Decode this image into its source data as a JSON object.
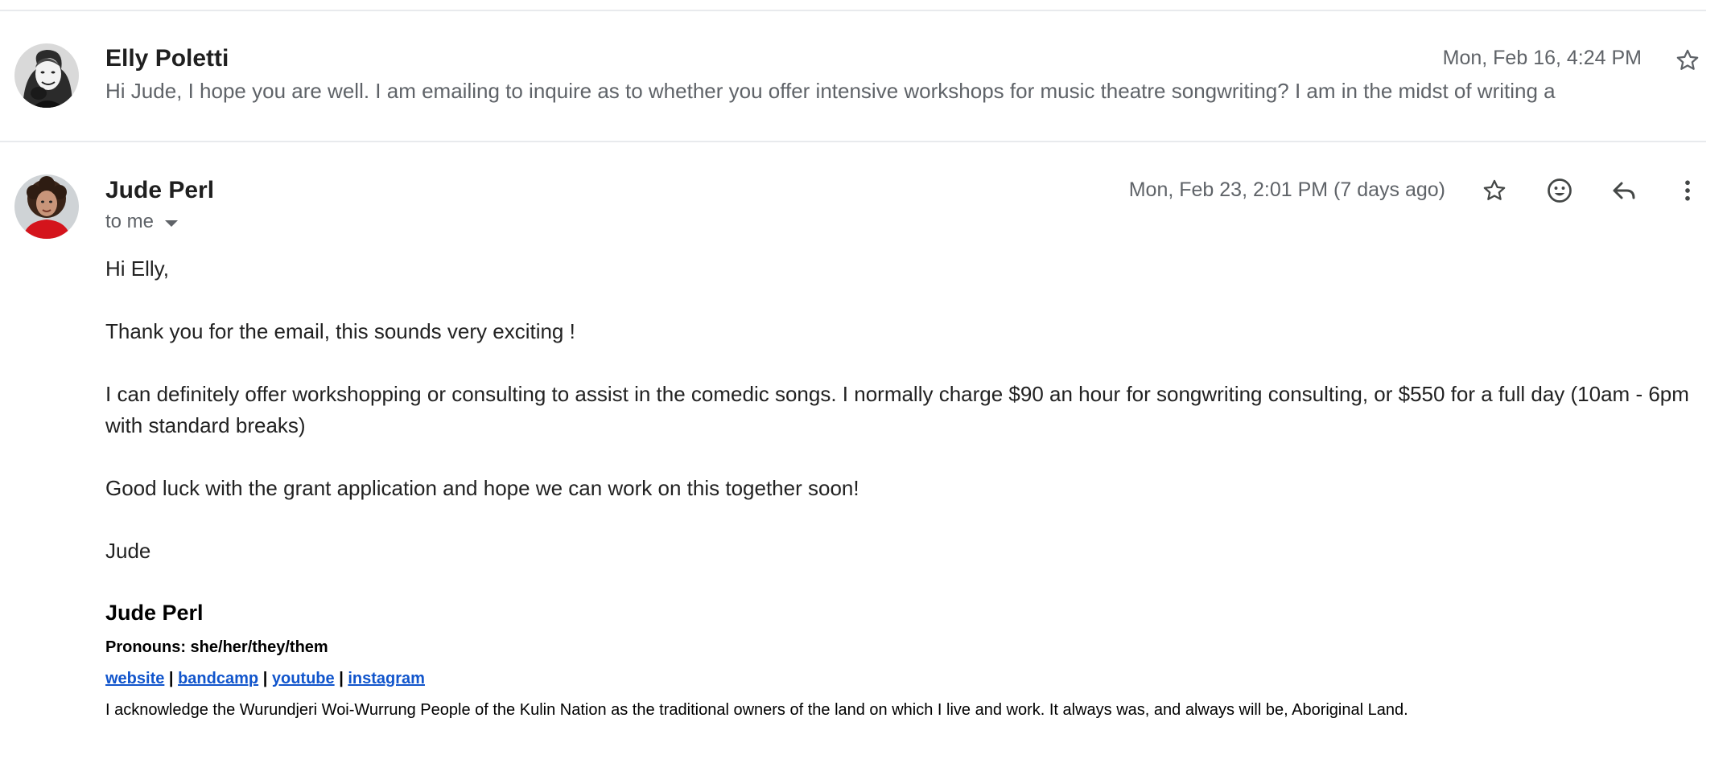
{
  "thread": {
    "messages": [
      {
        "sender": "Elly Poletti",
        "date": "Mon, Feb 16, 4:24 PM",
        "snippet": "Hi Jude, I hope you are well. I am emailing to inquire as to whether you offer intensive workshops for music theatre songwriting? I am in the midst of writing a"
      },
      {
        "sender": "Jude Perl",
        "date": "Mon, Feb 23, 2:01 PM (7 days ago)",
        "recipient_label": "to me",
        "body": {
          "greeting": "Hi Elly,",
          "p1": "Thank you for the email, this sounds very exciting !",
          "p2": "I can definitely offer workshopping or consulting to assist in the comedic songs. I normally charge $90 an hour for songwriting consulting, or $550 for a full day (10am - 6pm with standard breaks)",
          "p3": "Good luck with the grant application and hope we can work on this together soon!",
          "signoff": "Jude"
        },
        "signature": {
          "name": "Jude Perl",
          "pronouns": "Pronouns: she/her/they/them",
          "links": [
            "website",
            "bandcamp",
            "youtube",
            "instagram"
          ],
          "separator": "|",
          "acknowledgement": "I acknowledge the Wurundjeri Woi-Wurrung People of the Kulin Nation as the traditional owners of the land on which I live and work. It always was, and always will be, Aboriginal Land."
        }
      }
    ]
  },
  "icons": {
    "star": "star-icon",
    "emoji": "emoji-reaction-icon",
    "reply": "reply-icon",
    "more": "more-vert-icon"
  },
  "colors": {
    "link": "#1155cc",
    "muted": "#5f6368",
    "divider": "#e8eaed"
  }
}
